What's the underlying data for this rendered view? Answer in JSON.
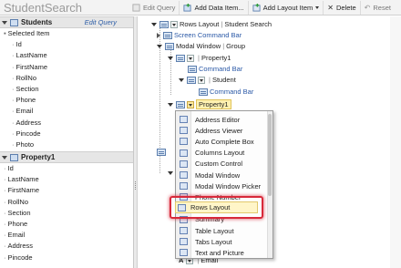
{
  "app": {
    "title": "StudentSearch"
  },
  "toolbar": {
    "edit_query": "Edit Query",
    "add_data_item": "Add Data Item...",
    "add_layout_item": "Add Layout Item",
    "delete": "Delete",
    "reset": "Reset"
  },
  "left": {
    "students_header": "Students",
    "edit_query_link": "Edit Query",
    "selected_item": "Selected Item",
    "selected_fields": [
      "Id",
      "LastName",
      "FirstName",
      "RollNo",
      "Section",
      "Phone",
      "Email",
      "Address",
      "Pincode",
      "Photo"
    ],
    "property_header": "Property1",
    "property_fields": [
      "Id",
      "LastName",
      "FirstName",
      "RollNo",
      "Section",
      "Phone",
      "Email",
      "Address",
      "Pincode"
    ]
  },
  "tree": {
    "root_label": "Rows Layout",
    "root_sep": "|",
    "root_name": "Student Search",
    "screen_command_bar": "Screen Command Bar",
    "modal_window": "Modal Window",
    "group": "Group",
    "property1": "Property1",
    "command_bar": "Command Bar",
    "student": "Student",
    "command_bar2": "Command Bar",
    "selected_property": "Property1",
    "bottom_text": "Email"
  },
  "menu": {
    "items": [
      "Address Editor",
      "Address Viewer",
      "Auto Complete Box",
      "Columns Layout",
      "Custom Control",
      "Modal Window",
      "Modal Window Picker",
      "Phone Number",
      "Rows Layout",
      "Summary",
      "Table Layout",
      "Tabs Layout",
      "Text and Picture"
    ],
    "highlighted": "Rows Layout"
  }
}
